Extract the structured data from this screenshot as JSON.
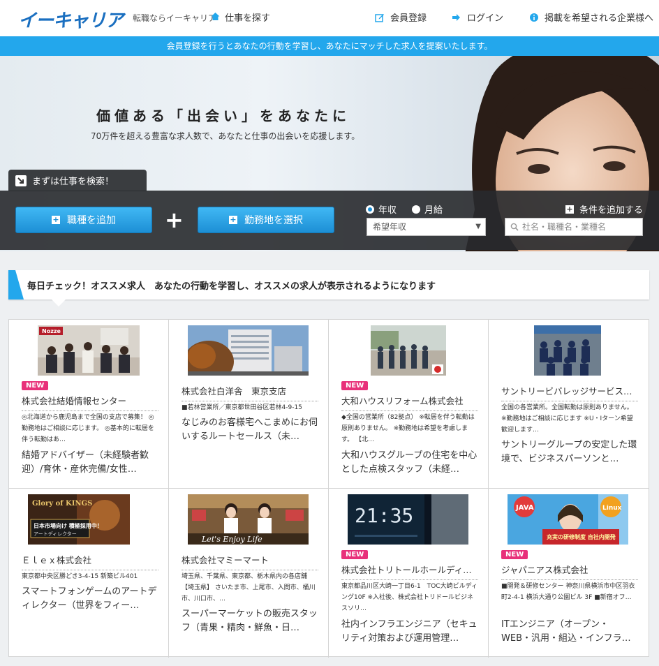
{
  "header": {
    "logo": "イーキャリア",
    "tagline": "転職ならイーキャリア",
    "job_search": "仕事を探す",
    "nav": [
      "会員登録",
      "ログイン",
      "掲載を希望される企業様へ"
    ]
  },
  "banner": "会員登録を行うとあなたの行動を学習し、あなたにマッチした求人を提案いたします。",
  "hero": {
    "title": "価値ある「出会い」をあなたに",
    "subtitle": "70万件を超える豊富な求人数で、あなたと仕事の出会いを応援します。"
  },
  "search": {
    "tab_label": "まずは仕事を検索！",
    "job_type_button": "職種を追加",
    "location_button": "勤務地を選択",
    "radio_annual": "年収",
    "radio_monthly": "月給",
    "salary_select": "希望年収",
    "add_condition": "条件を追加する",
    "keyword_placeholder": "社名・職種名・業種名"
  },
  "recommend": {
    "heading": "毎日チェック！オススメ求人　あなたの行動を学習し、オススメの求人が表示されるようになります"
  },
  "new_label": "NEW",
  "jobs": [
    {
      "company": "株式会社結婚情報センター",
      "location": "◎北海道から鹿児島まで全国の支店で募集！ ◎勤務地はご相談に応じます。 ◎基本的に転居を伴う転勤はあ…",
      "title": "結婚アドバイザー（未経験者歓迎）/育休・産休完備/女性…",
      "is_new": true
    },
    {
      "company": "株式会社白洋舎　東京支店",
      "location": "■若林営業所／東京都世田谷区若林4-9-15",
      "title": "なじみのお客様宅へこまめにお伺いするルートセールス（未…",
      "is_new": false
    },
    {
      "company": "大和ハウスリフォーム株式会社",
      "location": "◆全国の営業所（82拠点） ※転居を伴う転勤は原則ありません。 ※勤務地は希望を考慮します。 【北…",
      "title": "大和ハウスグループの住宅を中心とした点検スタッフ（未経…",
      "is_new": true
    },
    {
      "company": "サントリービバレッジサービス…",
      "location": "全国の各営業所。全国転勤は原則ありません。 ※勤務地はご相談に応じます ※U・Iターン希望歓迎します…",
      "title": "サントリーグループの安定した環境で、ビジネスパーソンと…",
      "is_new": false
    },
    {
      "company": "Ｅｌｅｘ株式会社",
      "location": "東京都中央区勝どき3-4-15 新築ビル401",
      "title": "スマートフォンゲームのアートディレクター（世界をフィー…",
      "is_new": false
    },
    {
      "company": "株式会社マミーマート",
      "location": "埼玉県、千葉県、東京都、栃木県内の各店舗 【埼玉県】 さいたま市、上尾市、入間市、桶川市、川口市、…",
      "title": "スーパーマーケットの販売スタッフ（青果・精肉・鮮魚・日…",
      "is_new": false
    },
    {
      "company": "株式会社トリトールホールディ…",
      "location": "東京都品川区大崎一丁目6-1　TOC大崎ビルディング10F ※入社後、株式会社トリドールビジネスソリ…",
      "title": "社内インフラエンジニア（セキュリティ対策および運用管理…",
      "is_new": true
    },
    {
      "company": "ジャパニアス株式会社",
      "location": "■開発＆研修センター 神奈川県横浜市中区羽衣町2-4-1 横浜大通り公園ビル 3F ■新宿オフ…",
      "title": "ITエンジニア（オープン・WEB・汎用・組込・インフラ…",
      "is_new": true
    }
  ],
  "thumb_texts": {
    "nozze": "Nozze",
    "gvk": "Glory of KINGS",
    "gvk_sub": "日本市場向け 積極採用中！",
    "gvk_role": "アートディレクター",
    "mammy": "Let's Enjoy Life",
    "clock": "21:35",
    "java": "JAVA",
    "linux": "Linux",
    "training": "充実の研修制度 自社内開発"
  },
  "colors": {
    "brand": "#1a6fc0",
    "accent": "#23a7ec",
    "new_badge": "#e8307a"
  }
}
